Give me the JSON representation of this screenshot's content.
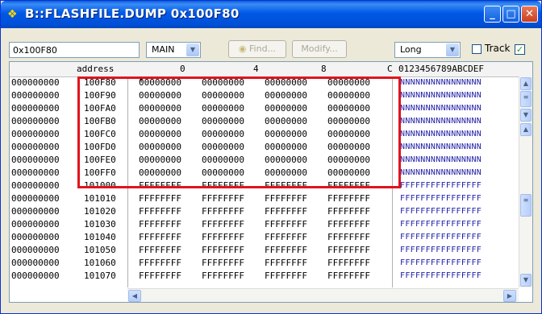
{
  "window": {
    "title": "B::FLASHFILE.DUMP 0x100F80"
  },
  "toolbar": {
    "address_value": "0x100F80",
    "memory_class": "MAIN",
    "find_label": "Find...",
    "modify_label": "Modify...",
    "width_select": "Long",
    "track_label": "Track",
    "track_checked": true
  },
  "header": {
    "address": "address",
    "col0": "0",
    "col4": "4",
    "col8": "8",
    "colC": "C",
    "ascii": "0123456789ABCDEF"
  },
  "rows": [
    {
      "addr": "000000000",
      "off": "100F80",
      "w": [
        "00000000",
        "00000000",
        "00000000",
        "00000000"
      ],
      "ascii": "NNNNNNNNNNNNNNNN"
    },
    {
      "addr": "000000000",
      "off": "100F90",
      "w": [
        "00000000",
        "00000000",
        "00000000",
        "00000000"
      ],
      "ascii": "NNNNNNNNNNNNNNNN"
    },
    {
      "addr": "000000000",
      "off": "100FA0",
      "w": [
        "00000000",
        "00000000",
        "00000000",
        "00000000"
      ],
      "ascii": "NNNNNNNNNNNNNNNN"
    },
    {
      "addr": "000000000",
      "off": "100FB0",
      "w": [
        "00000000",
        "00000000",
        "00000000",
        "00000000"
      ],
      "ascii": "NNNNNNNNNNNNNNNN"
    },
    {
      "addr": "000000000",
      "off": "100FC0",
      "w": [
        "00000000",
        "00000000",
        "00000000",
        "00000000"
      ],
      "ascii": "NNNNNNNNNNNNNNNN"
    },
    {
      "addr": "000000000",
      "off": "100FD0",
      "w": [
        "00000000",
        "00000000",
        "00000000",
        "00000000"
      ],
      "ascii": "NNNNNNNNNNNNNNNN"
    },
    {
      "addr": "000000000",
      "off": "100FE0",
      "w": [
        "00000000",
        "00000000",
        "00000000",
        "00000000"
      ],
      "ascii": "NNNNNNNNNNNNNNNN"
    },
    {
      "addr": "000000000",
      "off": "100FF0",
      "w": [
        "00000000",
        "00000000",
        "00000000",
        "00000000"
      ],
      "ascii": "NNNNNNNNNNNNNNNN"
    },
    {
      "addr": "000000000",
      "off": "101000",
      "w": [
        "FFFFFFFF",
        "FFFFFFFF",
        "FFFFFFFF",
        "FFFFFFFF"
      ],
      "ascii": "FFFFFFFFFFFFFFFF"
    },
    {
      "addr": "000000000",
      "off": "101010",
      "w": [
        "FFFFFFFF",
        "FFFFFFFF",
        "FFFFFFFF",
        "FFFFFFFF"
      ],
      "ascii": "FFFFFFFFFFFFFFFF"
    },
    {
      "addr": "000000000",
      "off": "101020",
      "w": [
        "FFFFFFFF",
        "FFFFFFFF",
        "FFFFFFFF",
        "FFFFFFFF"
      ],
      "ascii": "FFFFFFFFFFFFFFFF"
    },
    {
      "addr": "000000000",
      "off": "101030",
      "w": [
        "FFFFFFFF",
        "FFFFFFFF",
        "FFFFFFFF",
        "FFFFFFFF"
      ],
      "ascii": "FFFFFFFFFFFFFFFF"
    },
    {
      "addr": "000000000",
      "off": "101040",
      "w": [
        "FFFFFFFF",
        "FFFFFFFF",
        "FFFFFFFF",
        "FFFFFFFF"
      ],
      "ascii": "FFFFFFFFFFFFFFFF"
    },
    {
      "addr": "000000000",
      "off": "101050",
      "w": [
        "FFFFFFFF",
        "FFFFFFFF",
        "FFFFFFFF",
        "FFFFFFFF"
      ],
      "ascii": "FFFFFFFFFFFFFFFF"
    },
    {
      "addr": "000000000",
      "off": "101060",
      "w": [
        "FFFFFFFF",
        "FFFFFFFF",
        "FFFFFFFF",
        "FFFFFFFF"
      ],
      "ascii": "FFFFFFFFFFFFFFFF"
    },
    {
      "addr": "000000000",
      "off": "101070",
      "w": [
        "FFFFFFFF",
        "FFFFFFFF",
        "FFFFFFFF",
        "FFFFFFFF"
      ],
      "ascii": "FFFFFFFFFFFFFFFF"
    }
  ],
  "icons": {
    "title": "chip-icon",
    "find": "binoculars-icon"
  },
  "colors": {
    "title_bar": "#0058e6",
    "highlight": "#e0141c",
    "ascii_text": "#2020a8"
  }
}
